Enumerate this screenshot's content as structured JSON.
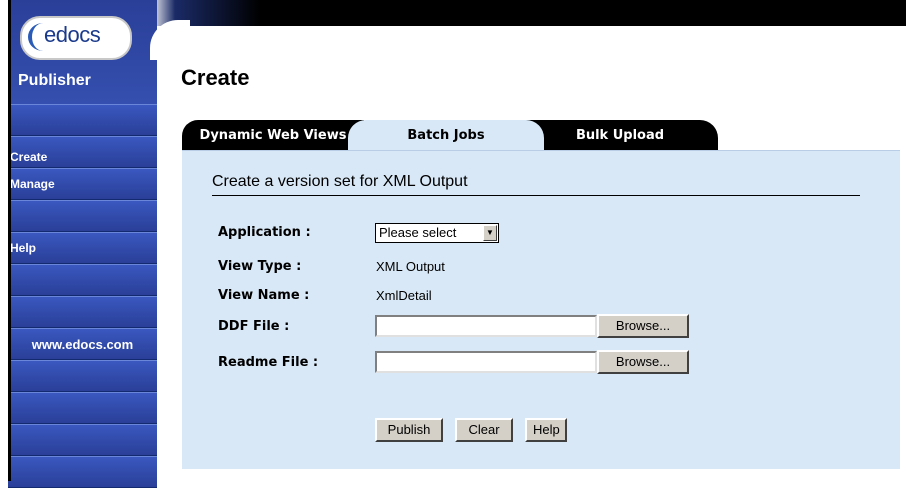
{
  "sidebar": {
    "logo_text": "edocs",
    "product": "Publisher",
    "items": [
      {
        "label": ""
      },
      {
        "label": "Create"
      },
      {
        "label": "Manage"
      },
      {
        "label": ""
      },
      {
        "label": "Help"
      },
      {
        "label": ""
      },
      {
        "label": ""
      },
      {
        "label": "www.edocs.com"
      },
      {
        "label": ""
      },
      {
        "label": ""
      },
      {
        "label": ""
      },
      {
        "label": ""
      }
    ]
  },
  "page": {
    "title": "Create"
  },
  "tabs": [
    {
      "label": "Dynamic Web Views",
      "active": false
    },
    {
      "label": "Batch Jobs",
      "active": true
    },
    {
      "label": "Bulk Upload",
      "active": false
    }
  ],
  "form": {
    "section_title": "Create a version set for XML Output",
    "application_label": "Application :",
    "application_value": "Please select",
    "view_type_label": "View Type :",
    "view_type_value": "XML Output",
    "view_name_label": "View Name :",
    "view_name_value": "XmlDetail",
    "ddf_label": "DDF File :",
    "ddf_value": "",
    "readme_label": "Readme File :",
    "readme_value": "",
    "browse_label": "Browse...",
    "publish_label": "Publish",
    "clear_label": "Clear",
    "help_label": "Help"
  },
  "colors": {
    "sidebar": "#2c44a0",
    "panel": "#d9e8f6",
    "tab_dark": "#000000"
  }
}
